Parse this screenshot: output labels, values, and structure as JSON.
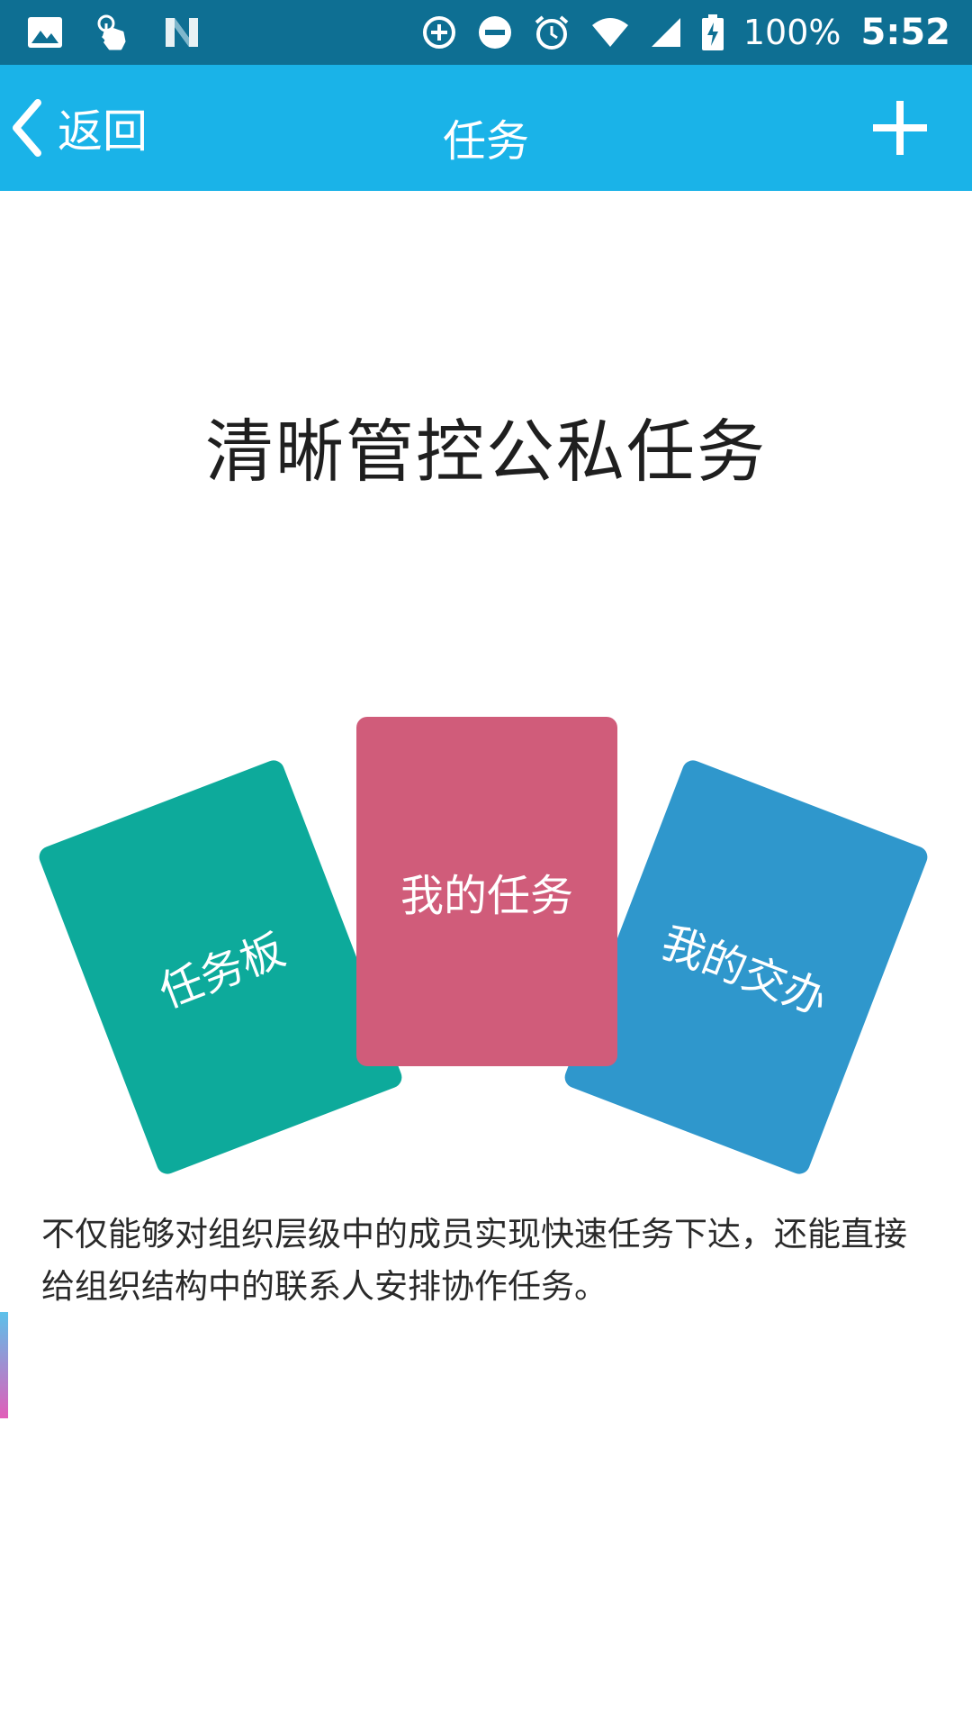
{
  "status_bar": {
    "battery_percent": "100%",
    "time": "5:52",
    "icons": [
      "image-icon",
      "touch-gesture-icon",
      "n-logo-icon",
      "data-saver-icon",
      "do-not-disturb-icon",
      "alarm-icon",
      "wifi-icon",
      "cell-signal-icon",
      "battery-charging-icon"
    ]
  },
  "app_bar": {
    "back_label": "返回",
    "title": "任务",
    "back_icon": "chevron-left-icon",
    "add_icon": "plus-icon",
    "color": "#1ab3e8"
  },
  "main": {
    "headline": "清晰管控公私任务",
    "cards": [
      {
        "label": "任务板",
        "color": "#0daa9b"
      },
      {
        "label": "我的任务",
        "color": "#d05c7a"
      },
      {
        "label": "我的交办",
        "color": "#2f97cc"
      }
    ],
    "description": "不仅能够对组织层级中的成员实现快速任务下达，还能直接给组织结构中的联系人安排协作任务。"
  }
}
